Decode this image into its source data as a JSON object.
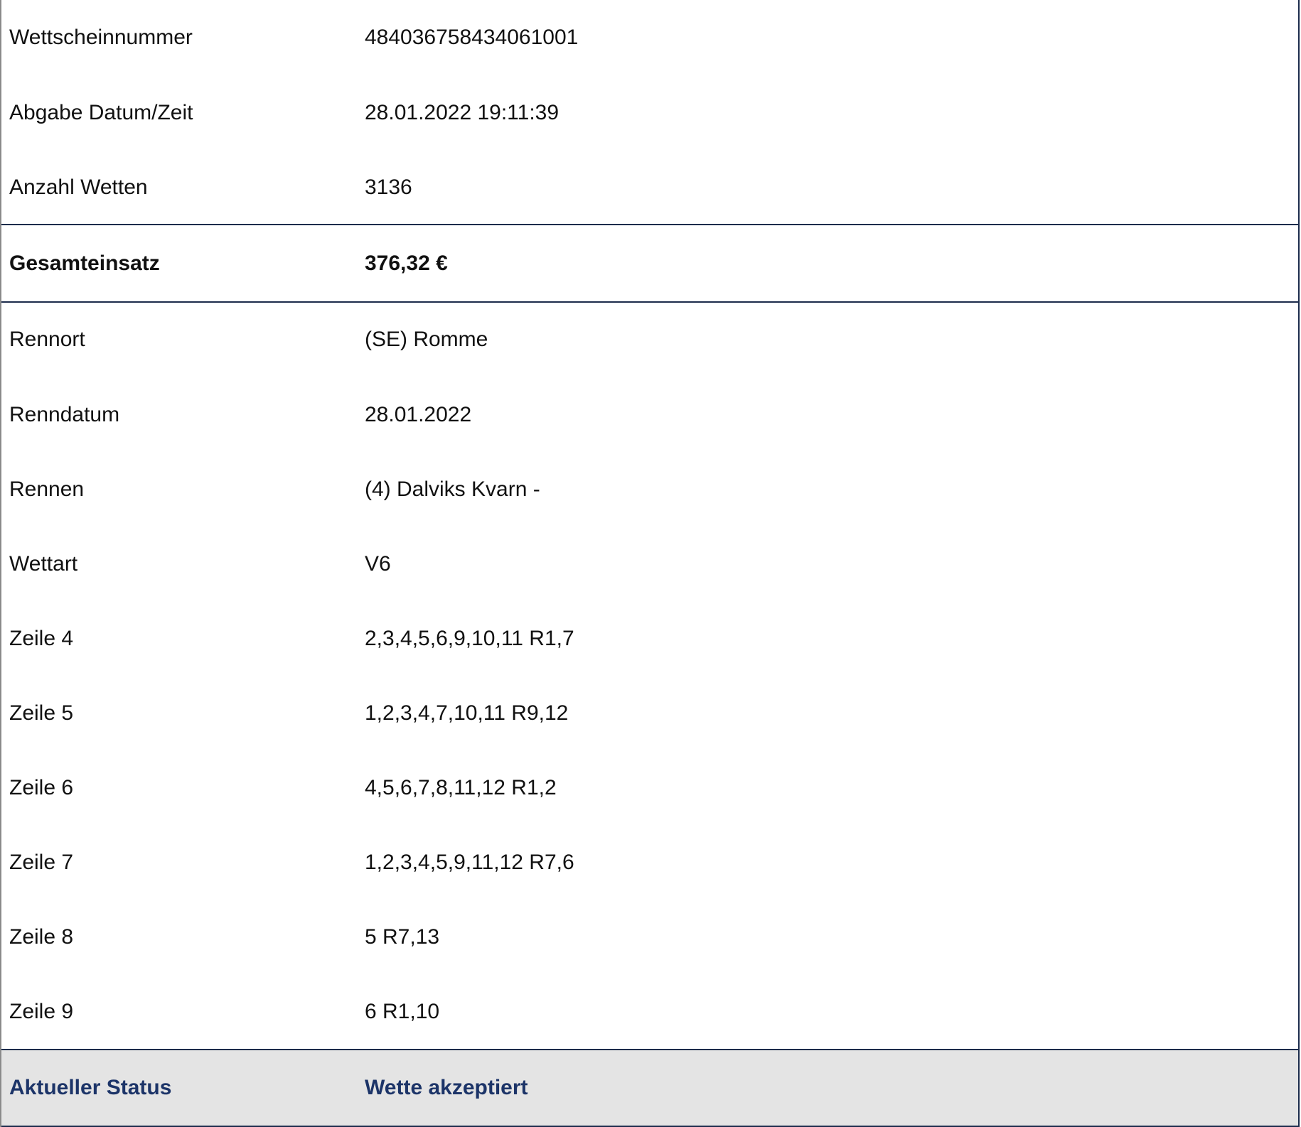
{
  "ticket": {
    "rows_top": [
      {
        "label": "Wettscheinnummer",
        "value": "484036758434061001"
      },
      {
        "label": "Abgabe Datum/Zeit",
        "value": "28.01.2022 19:11:39"
      },
      {
        "label": "Anzahl Wetten",
        "value": "3136"
      }
    ],
    "total": {
      "label": "Gesamteinsatz",
      "value": "376,32 €"
    },
    "rows_details": [
      {
        "label": "Rennort",
        "value": "(SE) Romme"
      },
      {
        "label": "Renndatum",
        "value": "28.01.2022"
      },
      {
        "label": "Rennen",
        "value": "(4) Dalviks Kvarn -"
      },
      {
        "label": "Wettart",
        "value": "V6"
      },
      {
        "label": "Zeile 4",
        "value": "2,3,4,5,6,9,10,11 R1,7"
      },
      {
        "label": "Zeile 5",
        "value": "1,2,3,4,7,10,11 R9,12"
      },
      {
        "label": "Zeile 6",
        "value": "4,5,6,7,8,11,12 R1,2"
      },
      {
        "label": "Zeile 7",
        "value": "1,2,3,4,5,9,11,12 R7,6"
      },
      {
        "label": "Zeile 8",
        "value": "5 R7,13"
      },
      {
        "label": "Zeile 9",
        "value": "6 R1,10"
      }
    ],
    "status": {
      "label": "Aktueller Status",
      "value": "Wette akzeptiert"
    }
  },
  "colors": {
    "divider": "#1c2c4c",
    "status_background": "#e4e4e4",
    "status_text": "#1c3468"
  }
}
